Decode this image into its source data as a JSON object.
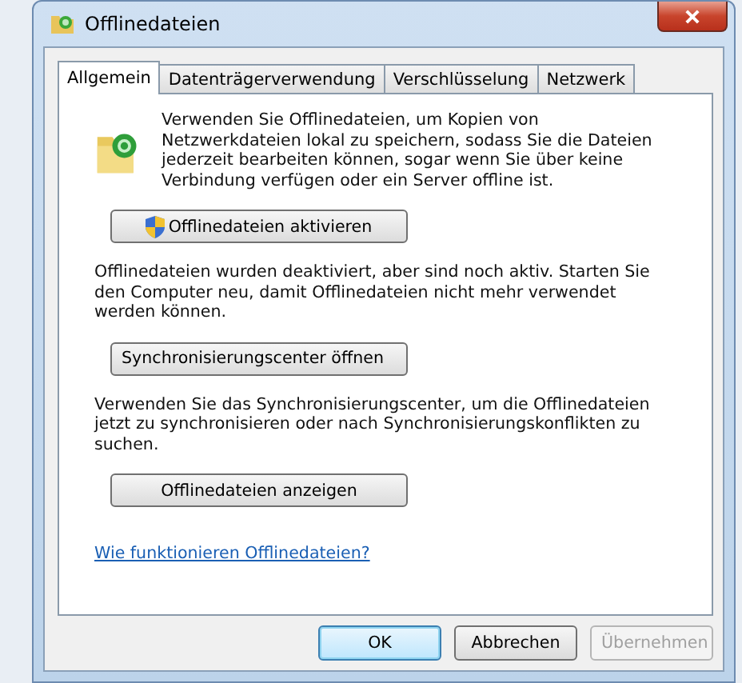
{
  "window": {
    "title": "Offlinedateien"
  },
  "tabs": [
    {
      "label": "Allgemein",
      "selected": true
    },
    {
      "label": "Datenträgerverwendung",
      "selected": false
    },
    {
      "label": "Verschlüsselung",
      "selected": false
    },
    {
      "label": "Netzwerk",
      "selected": false
    }
  ],
  "content": [
    {
      "kind": "intro",
      "text": "Verwenden Sie Offlinedateien, um Kopien von Netzwerkdateien lokal zu speichern, sodass Sie die Dateien jederzeit bearbeiten können, sogar wenn Sie über keine Verbindung verfügen oder ein Server offline ist."
    },
    {
      "kind": "shield-button",
      "text": "Offlinedateien aktivieren"
    },
    {
      "kind": "paragraph",
      "text": "Offlinedateien wurden deaktiviert, aber sind noch aktiv. Starten Sie den Computer neu, damit Offlinedateien nicht mehr verwendet werden können."
    },
    {
      "kind": "button",
      "text": "Synchronisierungscenter öffnen"
    },
    {
      "kind": "paragraph",
      "text": "Verwenden Sie das Synchronisierungscenter, um die Offlinedateien jetzt zu synchronisieren oder nach Synchronisierungskonflikten zu suchen."
    },
    {
      "kind": "button",
      "text": "Offlinedateien anzeigen"
    },
    {
      "kind": "link",
      "text": "Wie funktionieren Offlinedateien?"
    }
  ],
  "buttons": [
    {
      "label": "OK",
      "default": true,
      "disabled": false
    },
    {
      "label": "Abbrechen",
      "default": false,
      "disabled": false
    },
    {
      "label": "Übernehmen",
      "default": false,
      "disabled": true
    }
  ]
}
